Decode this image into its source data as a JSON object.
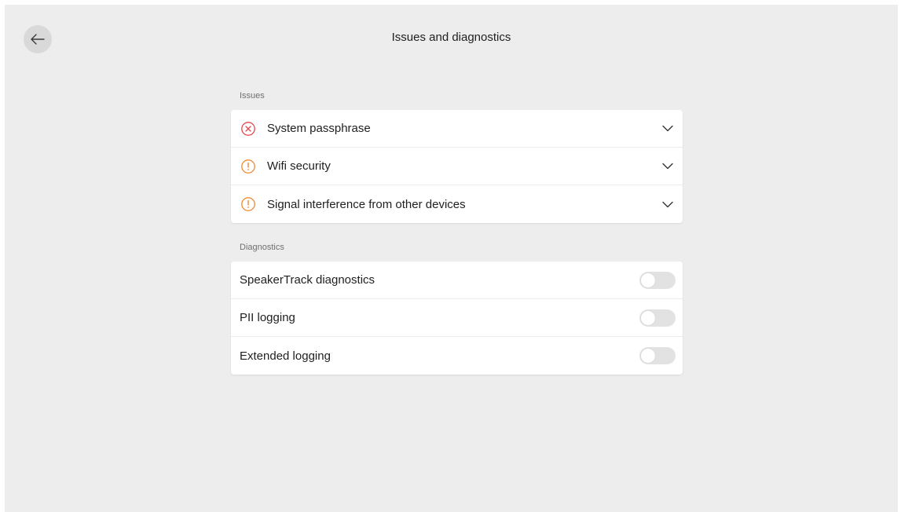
{
  "header": {
    "title": "Issues and diagnostics",
    "back_icon": "arrow-left-icon"
  },
  "issues": {
    "section_label": "Issues",
    "items": [
      {
        "label": "System passphrase",
        "status": "error",
        "icon": "error-x-icon",
        "color": "#e5484d"
      },
      {
        "label": "Wifi security",
        "status": "warning",
        "icon": "warning-exclamation-icon",
        "color": "#f08a30"
      },
      {
        "label": "Signal interference from other devices",
        "status": "warning",
        "icon": "warning-exclamation-icon",
        "color": "#f08a30"
      }
    ]
  },
  "diagnostics": {
    "section_label": "Diagnostics",
    "items": [
      {
        "label": "SpeakerTrack diagnostics",
        "enabled": false
      },
      {
        "label": "PII logging",
        "enabled": false
      },
      {
        "label": "Extended logging",
        "enabled": false
      }
    ]
  }
}
